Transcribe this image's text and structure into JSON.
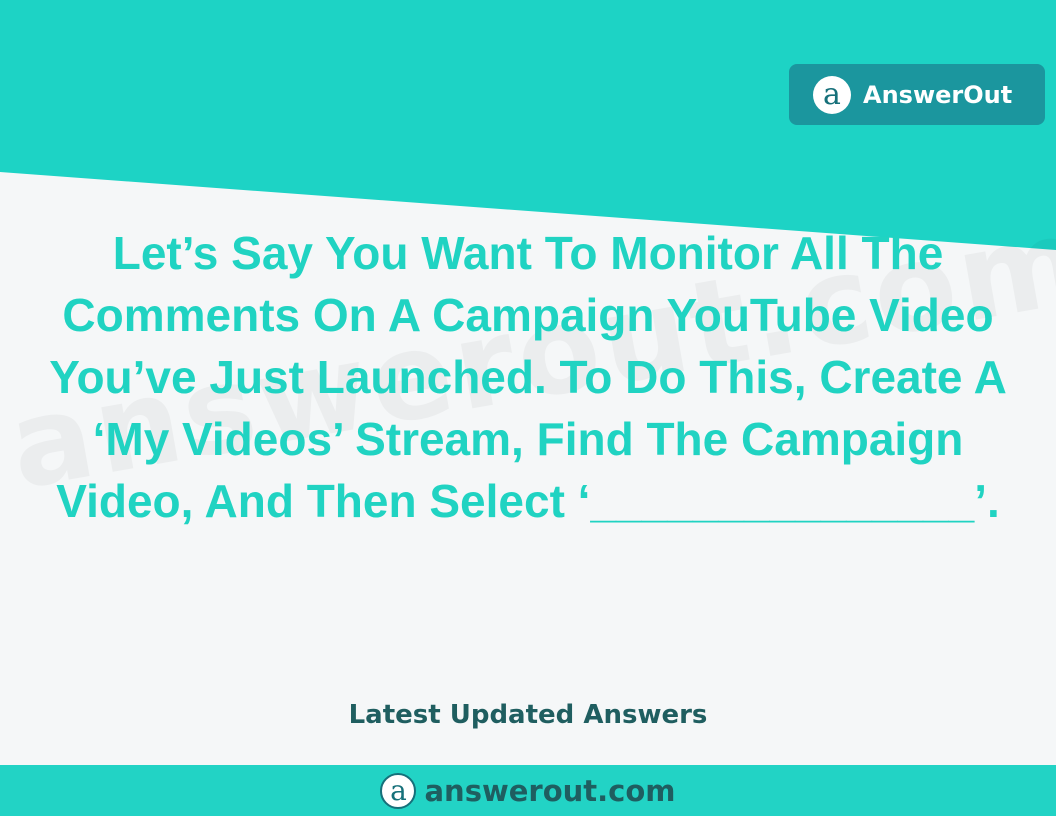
{
  "colors": {
    "accent": "#1dd3c5",
    "badge": "#1b969e",
    "question_text": "#20d3c2",
    "dark_text": "#1f5e60",
    "background": "#f5f7f8"
  },
  "header": {
    "logo_glyph": "a",
    "brand_name": "AnswerOut"
  },
  "watermark": "answerout.com",
  "question": {
    "text": "Let’s Say You Want To Monitor All The Comments On A Campaign YouTube Video You’ve Just Launched. To Do This, Create A ‘My Videos’ Stream, Find The Campaign Video, And Then Select ‘_______________’."
  },
  "tagline": "Latest Updated Answers",
  "footer": {
    "logo_glyph": "a",
    "site": "answerout.com"
  }
}
